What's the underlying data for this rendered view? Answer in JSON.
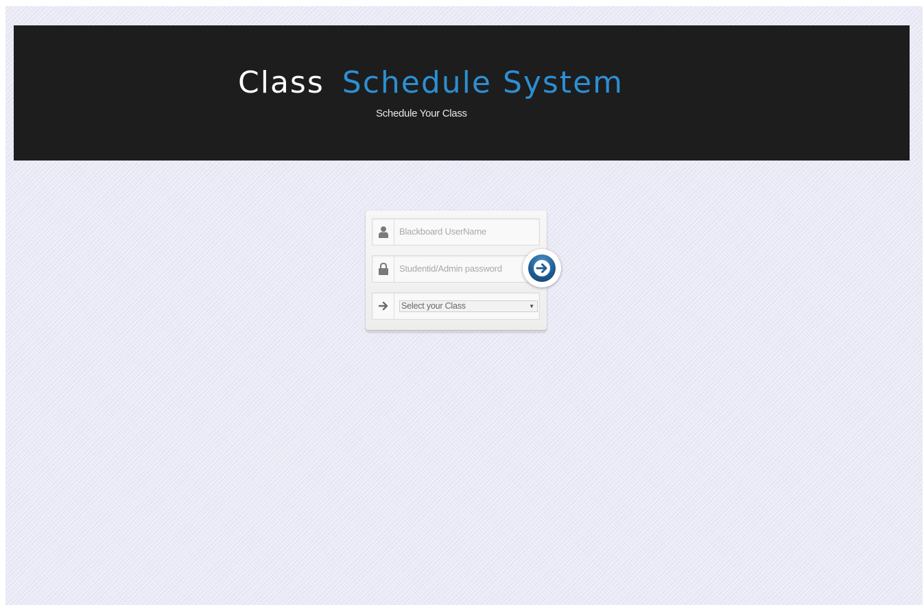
{
  "header": {
    "title_part1": "Class",
    "title_part2": "Schedule System",
    "subtitle": "Schedule Your Class"
  },
  "login": {
    "username_placeholder": "Blackboard UserName",
    "password_placeholder": "Studentid/Admin password",
    "class_select_value": "Select your Class",
    "icons": [
      "user-icon",
      "lock-icon",
      "arrow-right-icon",
      "submit-arrow-icon"
    ]
  },
  "colors": {
    "header_bg": "#1d1d1d",
    "title_accent": "#2c8fd3",
    "page_bg": "#eaebf6",
    "submit_button": "#1f5f95"
  }
}
